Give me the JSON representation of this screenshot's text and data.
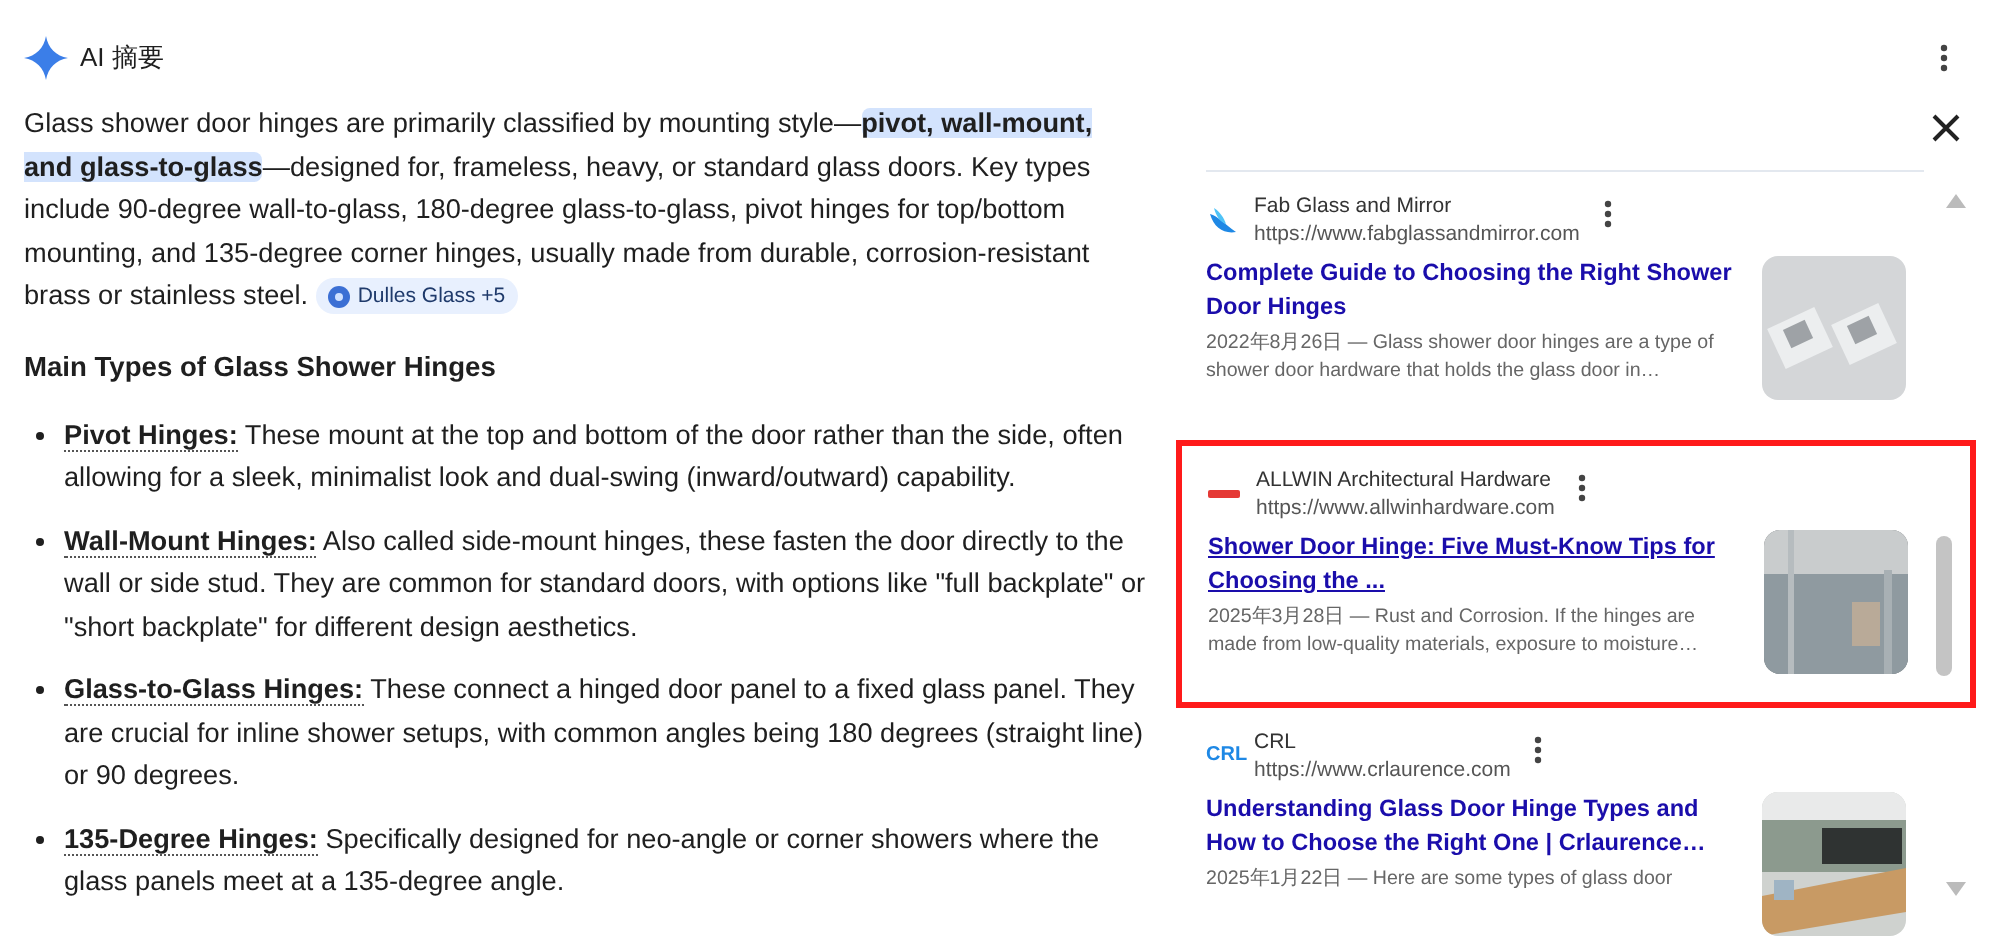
{
  "header": {
    "title": "AI 摘要"
  },
  "summary": {
    "before": "Glass shower door hinges are primarily classified by mounting style—",
    "highlight": "pivot, wall-mount, and glass-to-glass",
    "after": "—designed for, frameless, heavy, or standard glass doors. Key types include 90-degree wall-to-glass, 180-degree glass-to-glass, pivot hinges for top/bottom mounting, and 135-degree corner hinges, usually made from durable, corrosion-resistant brass or stainless steel.",
    "citation": "Dulles Glass +5"
  },
  "section_heading": "Main Types of Glass Shower Hinges",
  "items": [
    {
      "term": "Pivot Hinges:",
      "text": "These mount at the top and bottom of the door rather than the side, often allowing for a sleek, minimalist look and dual-swing (inward/outward) capability."
    },
    {
      "term": "Wall-Mount Hinges:",
      "text": "Also called side-mount hinges, these fasten the door directly to the wall or side stud. They are common for standard doors, with options like \"full backplate\" or \"short backplate\" for different design aesthetics."
    },
    {
      "term": "Glass-to-Glass Hinges:",
      "text": "These connect a hinged door panel to a fixed glass panel. They are crucial for inline shower setups, with common angles being 180 degrees (straight line) or 90 degrees."
    },
    {
      "term": "135-Degree Hinges:",
      "text": "Specifically designed for neo-angle or corner showers where the glass panels meet at a 135-degree angle."
    }
  ],
  "sources": [
    {
      "kind": "wing",
      "site": "Fab Glass and Mirror",
      "url": "https://www.fabglassandmirror.com",
      "title": "Complete Guide to Choosing the Right Shower Door Hinges",
      "snippet": "2022年8月26日 — Glass shower door hinges are a type of shower door hardware that holds the glass door in…",
      "highlighted": false
    },
    {
      "kind": "wordmark",
      "site": "ALLWIN Architectural Hardware",
      "url": "https://www.allwinhardware.com",
      "title": "Shower Door Hinge: Five Must-Know Tips for Choosing the ...",
      "snippet": "2025年3月28日 — Rust and Corrosion. If the hinges are made from low-quality materials, exposure to moisture…",
      "highlighted": true
    },
    {
      "kind": "text",
      "logo_text": "CRL",
      "site": "CRL",
      "url": "https://www.crlaurence.com",
      "title": "Understanding Glass Door Hinge Types and How to Choose the Right One | Crlaurence…",
      "snippet": "2025年1月22日 — Here are some types of glass door",
      "highlighted": false
    }
  ]
}
